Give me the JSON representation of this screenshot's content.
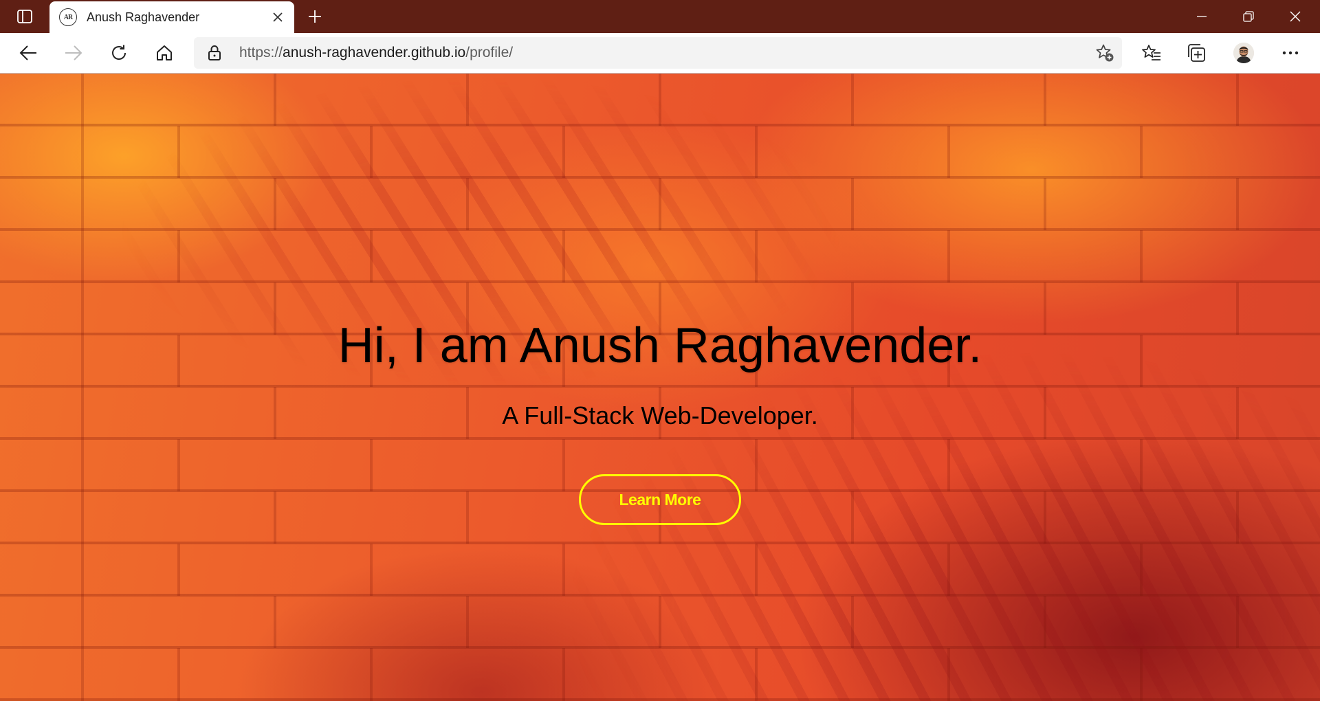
{
  "window": {
    "tab": {
      "title": "Anush Raghavender",
      "favicon_text": "AR"
    },
    "controls": {
      "minimize_icon": "minimize-icon",
      "restore_icon": "restore-icon",
      "close_icon": "close-icon"
    }
  },
  "toolbar": {
    "url_scheme": "https://",
    "url_host": "anush-raghavender.github.io",
    "url_path": "/profile/"
  },
  "hero": {
    "title": "Hi, I am Anush Raghavender.",
    "subtitle": "A Full-Stack Web-Developer.",
    "button_label": "Learn More"
  },
  "colors": {
    "titlebar": "#5f1f14",
    "button_accent": "#ffff00",
    "hero_text": "#ffffff",
    "background_main": "#ec5a2c"
  }
}
